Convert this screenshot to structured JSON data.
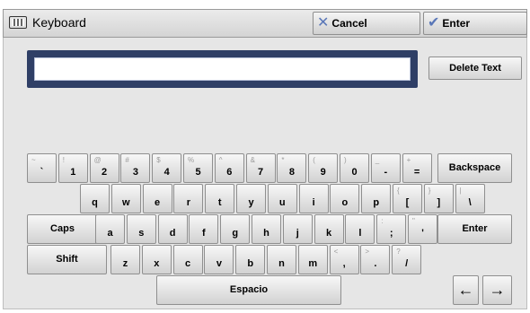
{
  "window": {
    "title": "Keyboard"
  },
  "toolbar": {
    "cancel_label": "Cancel",
    "enter_label": "Enter"
  },
  "input": {
    "value": "",
    "delete_label": "Delete Text"
  },
  "keys": {
    "row1": [
      {
        "main": "`",
        "sub": "~"
      },
      {
        "main": "1",
        "sub": "!"
      },
      {
        "main": "2",
        "sub": "@"
      },
      {
        "main": "3",
        "sub": "#"
      },
      {
        "main": "4",
        "sub": "$"
      },
      {
        "main": "5",
        "sub": "%"
      },
      {
        "main": "6",
        "sub": "^"
      },
      {
        "main": "7",
        "sub": "&"
      },
      {
        "main": "8",
        "sub": "*"
      },
      {
        "main": "9",
        "sub": "("
      },
      {
        "main": "0",
        "sub": ")"
      },
      {
        "main": "-",
        "sub": "_"
      },
      {
        "main": "=",
        "sub": "+"
      }
    ],
    "backspace": "Backspace",
    "row2": [
      {
        "main": "q"
      },
      {
        "main": "w"
      },
      {
        "main": "e"
      },
      {
        "main": "r"
      },
      {
        "main": "t"
      },
      {
        "main": "y"
      },
      {
        "main": "u"
      },
      {
        "main": "i"
      },
      {
        "main": "o"
      },
      {
        "main": "p"
      },
      {
        "main": "[",
        "sub": "{"
      },
      {
        "main": "]",
        "sub": "}"
      },
      {
        "main": "\\",
        "sub": "|"
      }
    ],
    "caps": "Caps",
    "row3": [
      {
        "main": "a"
      },
      {
        "main": "s"
      },
      {
        "main": "d"
      },
      {
        "main": "f"
      },
      {
        "main": "g"
      },
      {
        "main": "h"
      },
      {
        "main": "j"
      },
      {
        "main": "k"
      },
      {
        "main": "l"
      },
      {
        "main": ";",
        "sub": ":"
      },
      {
        "main": "'",
        "sub": "\""
      }
    ],
    "enter": "Enter",
    "shift": "Shift",
    "row4": [
      {
        "main": "z"
      },
      {
        "main": "x"
      },
      {
        "main": "c"
      },
      {
        "main": "v"
      },
      {
        "main": "b"
      },
      {
        "main": "n"
      },
      {
        "main": "m"
      },
      {
        "main": ",",
        "sub": "<"
      },
      {
        "main": ".",
        "sub": ">"
      },
      {
        "main": "/",
        "sub": "?"
      }
    ],
    "space": "Espacio",
    "left_arrow": "←",
    "right_arrow": "→"
  },
  "icons": {
    "keyboard": "keyboard-icon",
    "cancel": "close-icon",
    "enter": "checkmark-icon"
  }
}
